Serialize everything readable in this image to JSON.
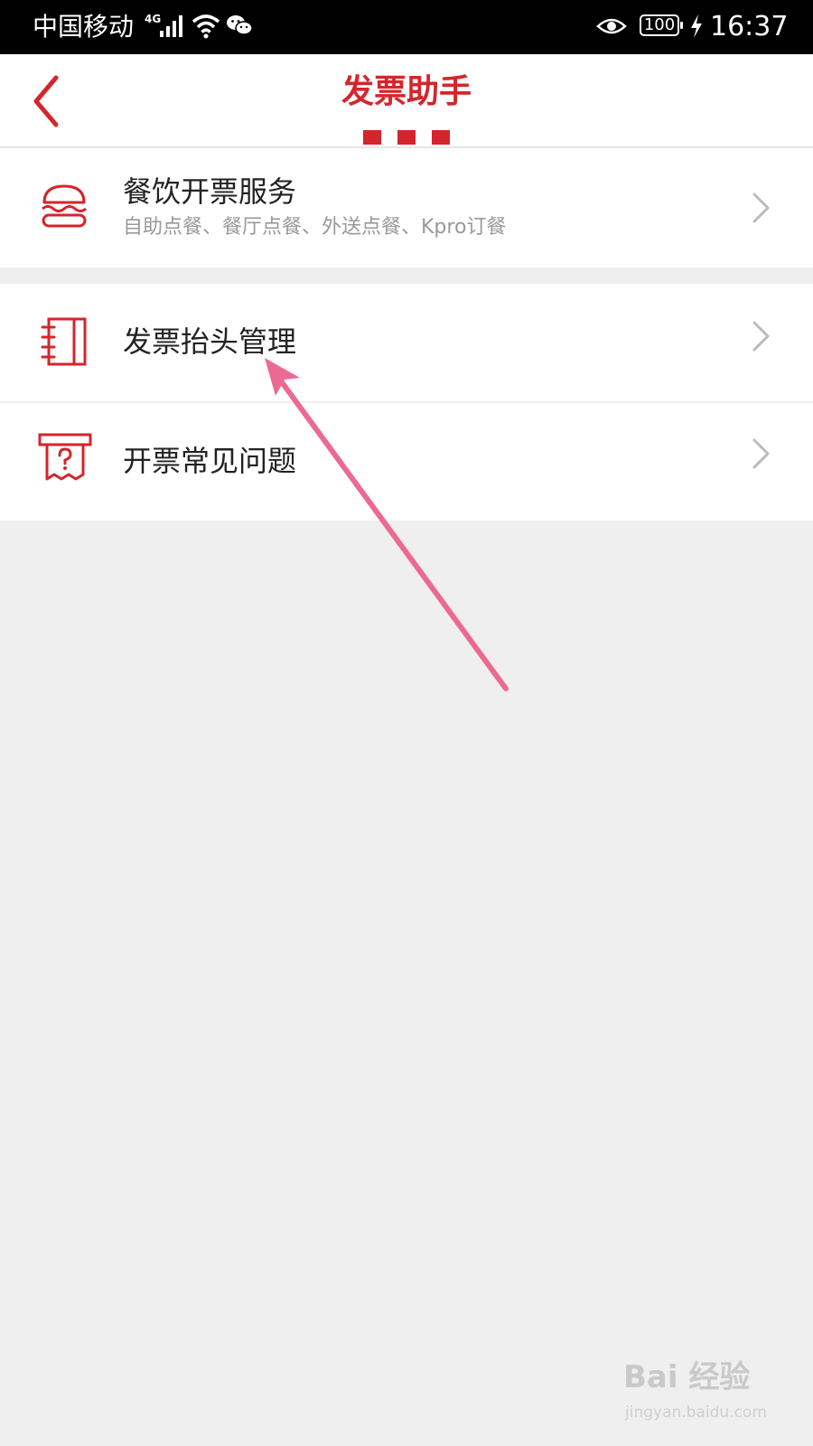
{
  "status_bar": {
    "carrier": "中国移动",
    "network": "4G",
    "battery": "100",
    "time": "16:37"
  },
  "header": {
    "title": "发票助手",
    "accent_color": "#d3262c"
  },
  "menu": {
    "food": {
      "label": "餐饮开票服务",
      "subtitle": "自助点餐、餐厅点餐、外送点餐、Kpro订餐",
      "icon": "burger-icon"
    },
    "invoice_header": {
      "label": "发票抬头管理",
      "icon": "notebook-icon"
    },
    "faq": {
      "label": "开票常见问题",
      "icon": "receipt-question-icon"
    }
  },
  "watermark": {
    "brand": "Bai 经验",
    "url": "jingyan.baidu.com"
  }
}
